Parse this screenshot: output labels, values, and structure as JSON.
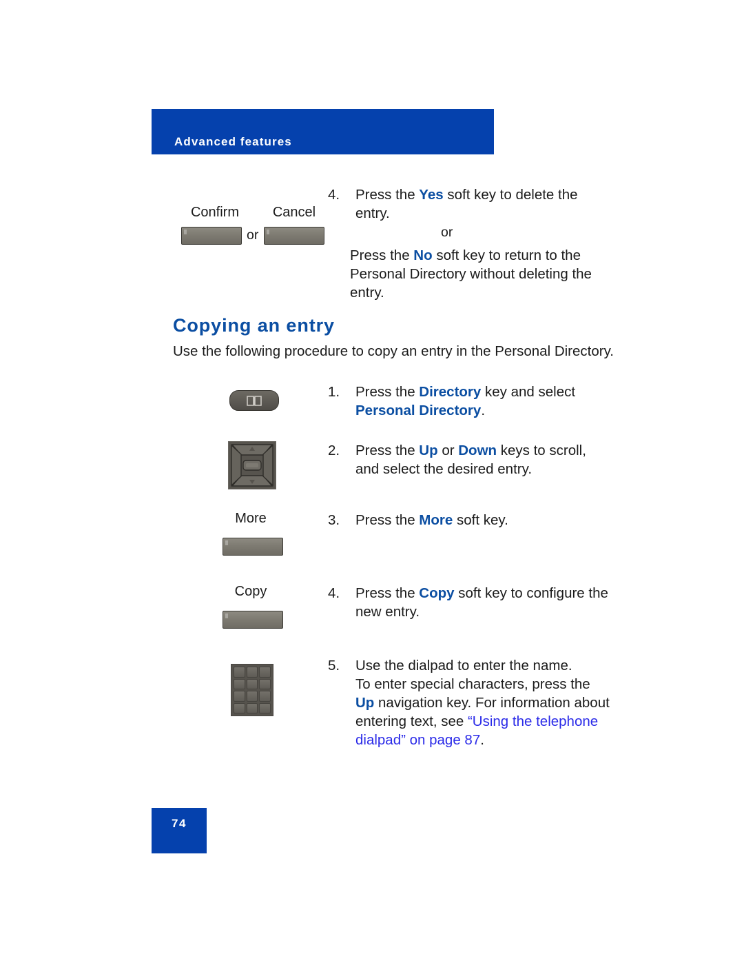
{
  "header": {
    "title": "Advanced features",
    "bar_color": "#0541ad"
  },
  "top_step": {
    "number": "4.",
    "line1_pre": "Press the ",
    "line1_key": "Yes",
    "line1_post": " soft key to delete the",
    "line2": "entry.",
    "or": "or",
    "line3_pre": "Press the ",
    "line3_key": "No",
    "line3_post": " soft key to return to the",
    "line4": "Personal Directory without deleting the",
    "line5": "entry."
  },
  "top_keys": {
    "confirm_label": "Confirm",
    "cancel_label": "Cancel",
    "or": "or"
  },
  "section": {
    "heading": "Copying an entry",
    "intro": "Use the following procedure to copy an entry in the Personal Directory."
  },
  "steps": [
    {
      "number": "1.",
      "icon": "directory-book-key",
      "line1_pre": "Press the ",
      "line1_key": "Directory",
      "line1_post": " key and select",
      "line2_key": "Personal Directory",
      "line2_post": "."
    },
    {
      "number": "2.",
      "icon": "navigation-cluster-key",
      "line1_pre": "Press the ",
      "line1_key_a": "Up",
      "line1_mid": " or ",
      "line1_key_b": "Down",
      "line1_post": " keys to scroll,",
      "line2": "and select the desired entry."
    },
    {
      "number": "3.",
      "icon": "softkey",
      "softkey_label": "More",
      "line1_pre": "Press the ",
      "line1_key": "More",
      "line1_post": " soft key."
    },
    {
      "number": "4.",
      "icon": "softkey",
      "softkey_label": "Copy",
      "line1_pre": "Press the ",
      "line1_key": "Copy",
      "line1_post": " soft key to configure the",
      "line2": "new entry."
    },
    {
      "number": "5.",
      "icon": "dialpad-keys",
      "line1": "Use the dialpad to enter the name.",
      "line2": "To enter special characters, press the",
      "line3_key": "Up",
      "line3_post": " navigation key. For information about",
      "line4_pre": "entering text, see ",
      "line4_link": "“Using the telephone",
      "line5_link": "dialpad” on page 87",
      "line5_post": "."
    }
  ],
  "footer": {
    "page_number": "74"
  },
  "colors": {
    "brand_blue": "#0541ad",
    "bold_key_blue": "#0b4ea2",
    "xref_blue": "#2a2ae8"
  }
}
